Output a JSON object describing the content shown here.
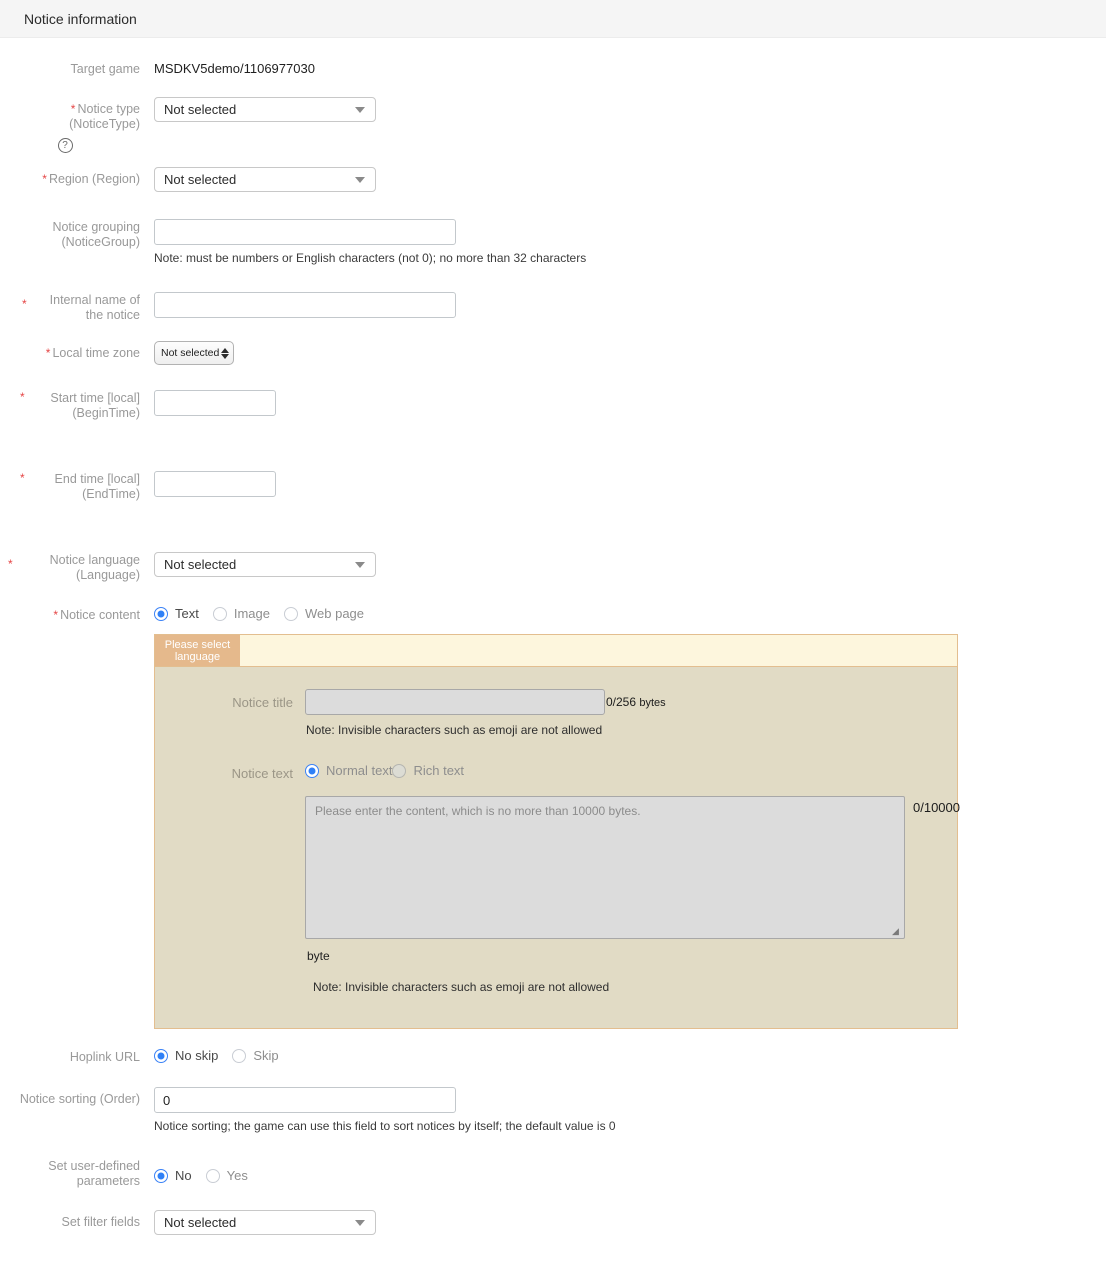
{
  "header": {
    "title": "Notice information"
  },
  "form": {
    "target_game": {
      "label": "Target game",
      "value": "MSDKV5demo/1106977030"
    },
    "notice_type": {
      "label": "Notice type (NoticeType)",
      "required": true,
      "value": "Not selected",
      "help_icon": "help-circle-icon"
    },
    "region": {
      "label": "Region (Region)",
      "required": true,
      "value": "Not selected"
    },
    "notice_group": {
      "label_line1": "Notice grouping",
      "label_line2": "(NoticeGroup)",
      "value": "",
      "note": "Note: must be numbers or English characters (not 0); no more than 32 characters"
    },
    "internal_name": {
      "label_line1": "Internal name of",
      "label_line2": "the notice",
      "required": true,
      "value": ""
    },
    "local_time_zone": {
      "label": "Local time zone",
      "required": true,
      "value": "Not selected"
    },
    "begin_time": {
      "label_line1": "Start time [local]",
      "label_line2": "(BeginTime)",
      "required": true,
      "value": ""
    },
    "end_time": {
      "label_line1": "End time [local]",
      "label_line2": "(EndTime)",
      "required": true,
      "value": ""
    },
    "notice_language": {
      "label_line1": "Notice language",
      "label_line2": "(Language)",
      "required": true,
      "value": "Not selected"
    },
    "notice_content": {
      "label": "Notice content",
      "required": true,
      "options": [
        {
          "label": "Text",
          "selected": true
        },
        {
          "label": "Image",
          "selected": false
        },
        {
          "label": "Web page",
          "selected": false
        }
      ]
    },
    "hoplink_url": {
      "label": "Hoplink URL",
      "options": [
        {
          "label": "No skip",
          "selected": true
        },
        {
          "label": "Skip",
          "selected": false
        }
      ]
    },
    "notice_order": {
      "label": "Notice sorting (Order)",
      "value": "0",
      "note": "Notice sorting; the game can use this field to sort notices by itself; the default value is 0"
    },
    "user_defined_params": {
      "label_line1": "Set user-defined",
      "label_line2": "parameters",
      "options": [
        {
          "label": "No",
          "selected": true
        },
        {
          "label": "Yes",
          "selected": false
        }
      ]
    },
    "filter_fields": {
      "label": "Set filter fields",
      "value": "Not selected"
    }
  },
  "language_panel": {
    "tab": {
      "line1": "Please select",
      "line2": "language"
    },
    "notice_title": {
      "label": "Notice title",
      "value": "",
      "counter": "0/256",
      "counter_unit": "bytes",
      "note": "Note: Invisible characters such as emoji are not allowed"
    },
    "notice_text": {
      "label": "Notice text",
      "options": [
        {
          "label": "Normal text",
          "selected": true
        },
        {
          "label": "Rich text",
          "selected": false
        }
      ],
      "placeholder": "Please enter the content, which is no more than 10000 bytes.",
      "value": "",
      "counter": "0/10000",
      "byte_label": "byte",
      "note": "Note: Invisible characters such as emoji are not allowed"
    }
  },
  "colors": {
    "header_bg": "#f5f5f5",
    "required_star": "#e54545",
    "radio_active": "#2f80f7",
    "panel_bg": "#e1dbc5",
    "panel_border": "#e3be8f",
    "tab_bg": "#e5b98c",
    "tabbar_bg": "#fdf6dd",
    "disabled_field": "#dcdcdc"
  }
}
